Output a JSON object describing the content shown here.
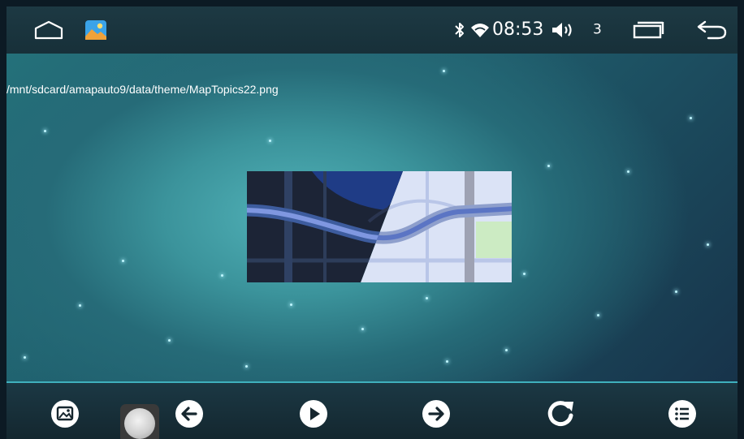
{
  "status_bar": {
    "time": "08:53",
    "volume_level": "3",
    "icons": [
      "home-icon",
      "gallery-app-icon",
      "bluetooth-icon",
      "wifi-icon",
      "volume-icon",
      "recent-apps-icon",
      "back-icon"
    ]
  },
  "viewer": {
    "file_path": "/mnt/sdcard/amapauto9/data/theme/MapTopics22.png",
    "image_subject": "map-theme-thumbnail"
  },
  "controls": {
    "buttons": [
      "gallery-icon",
      "previous-icon",
      "play-icon",
      "next-icon",
      "rotate-icon",
      "list-icon"
    ],
    "floating_ball": "assistive-ball"
  },
  "colors": {
    "accent": "#3fb0bd",
    "bar_background": "#173039",
    "map_dark": "#1c2436",
    "map_light": "#dbe3f6",
    "map_road": "#5b75c4",
    "map_park": "#ccebc3"
  }
}
